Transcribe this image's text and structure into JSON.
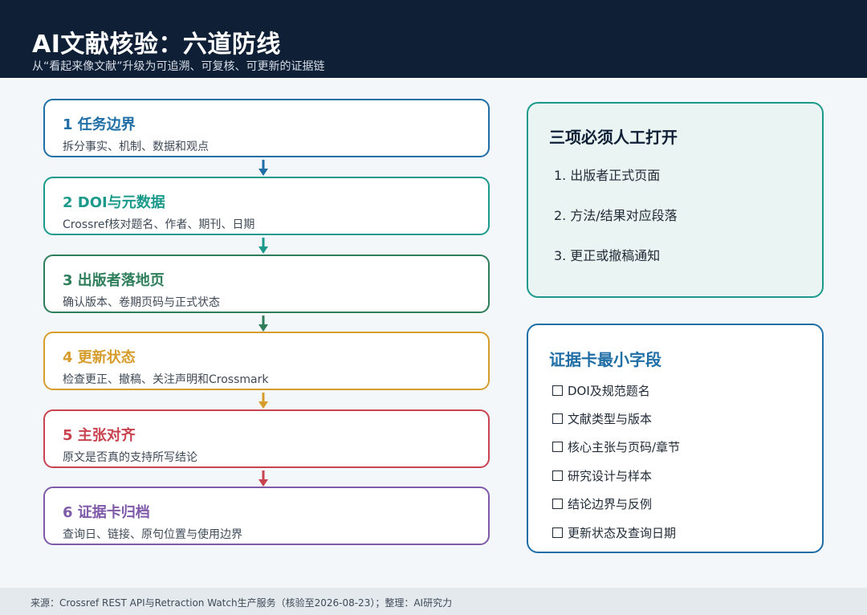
{
  "header": {
    "title": "AI文献核验：六道防线",
    "subtitle": "从“看起来像文献”升级为可追溯、可复核、可更新的证据链"
  },
  "steps": [
    {
      "title": "1 任务边界",
      "desc": "拆分事实、机制、数据和观点",
      "color": "#1f6ea6"
    },
    {
      "title": "2 DOI与元数据",
      "desc": "Crossref核对题名、作者、期刊、日期",
      "color": "#1b9a8b"
    },
    {
      "title": "3 出版者落地页",
      "desc": "确认版本、卷期页码与正式状态",
      "color": "#2e7d5b"
    },
    {
      "title": "4 更新状态",
      "desc": "检查更正、撤稿、关注声明和Crossmark",
      "color": "#d69d2c"
    },
    {
      "title": "5 主张对齐",
      "desc": "原文是否真的支持所写结论",
      "color": "#c8434f"
    },
    {
      "title": "6 证据卡归档",
      "desc": "查询日、链接、原句位置与使用边界",
      "color": "#7e5aa8"
    }
  ],
  "manual_panel": {
    "title": "三项必须人工打开",
    "items": [
      {
        "num": "1.",
        "text": "出版者正式页面"
      },
      {
        "num": "2.",
        "text": "方法/结果对应段落"
      },
      {
        "num": "3.",
        "text": "更正或撤稿通知"
      }
    ],
    "border_color": "#1b9a8b",
    "background": "#eaf4f2"
  },
  "card_panel": {
    "title": "证据卡最小字段",
    "items": [
      "DOI及规范题名",
      "文献类型与版本",
      "核心主张与页码/章节",
      "研究设计与样本",
      "结论边界与反例",
      "更新状态及查询日期"
    ],
    "border_color": "#1f6ea6"
  },
  "footer": {
    "text": "来源：Crossref REST API与Retraction Watch生产服务（核验至2026-08-23）；整理：AI研究力"
  }
}
